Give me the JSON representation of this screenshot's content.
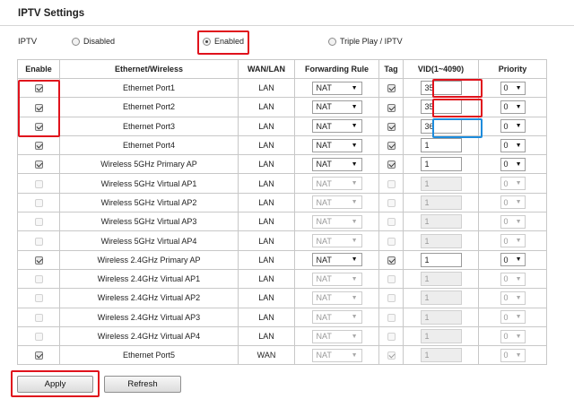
{
  "title": "IPTV Settings",
  "iptv": {
    "label": "IPTV",
    "options": [
      {
        "label": "Disabled",
        "checked": false
      },
      {
        "label": "Enabled",
        "checked": true
      },
      {
        "label": "Triple Play / IPTV",
        "checked": false
      }
    ]
  },
  "table": {
    "headers": [
      "Enable",
      "Ethernet/Wireless",
      "WAN/LAN",
      "Forwarding Rule",
      "Tag",
      "VID(1~4090)",
      "Priority"
    ],
    "rows": [
      {
        "enable": true,
        "name": "Ethernet Port1",
        "wanlan": "LAN",
        "rule": "NAT",
        "tag": true,
        "vid": "35",
        "priority": "0",
        "active": true
      },
      {
        "enable": true,
        "name": "Ethernet Port2",
        "wanlan": "LAN",
        "rule": "NAT",
        "tag": true,
        "vid": "35",
        "priority": "0",
        "active": true
      },
      {
        "enable": true,
        "name": "Ethernet Port3",
        "wanlan": "LAN",
        "rule": "NAT",
        "tag": true,
        "vid": "36",
        "priority": "0",
        "active": true
      },
      {
        "enable": true,
        "name": "Ethernet Port4",
        "wanlan": "LAN",
        "rule": "NAT",
        "tag": true,
        "vid": "1",
        "priority": "0",
        "active": true
      },
      {
        "enable": true,
        "name": "Wireless 5GHz Primary AP",
        "wanlan": "LAN",
        "rule": "NAT",
        "tag": true,
        "vid": "1",
        "priority": "0",
        "active": true
      },
      {
        "enable": false,
        "name": "Wireless 5GHz Virtual AP1",
        "wanlan": "LAN",
        "rule": "NAT",
        "tag": false,
        "vid": "1",
        "priority": "0",
        "active": false
      },
      {
        "enable": false,
        "name": "Wireless 5GHz Virtual AP2",
        "wanlan": "LAN",
        "rule": "NAT",
        "tag": false,
        "vid": "1",
        "priority": "0",
        "active": false
      },
      {
        "enable": false,
        "name": "Wireless 5GHz Virtual AP3",
        "wanlan": "LAN",
        "rule": "NAT",
        "tag": false,
        "vid": "1",
        "priority": "0",
        "active": false
      },
      {
        "enable": false,
        "name": "Wireless 5GHz Virtual AP4",
        "wanlan": "LAN",
        "rule": "NAT",
        "tag": false,
        "vid": "1",
        "priority": "0",
        "active": false
      },
      {
        "enable": true,
        "name": "Wireless 2.4GHz Primary AP",
        "wanlan": "LAN",
        "rule": "NAT",
        "tag": true,
        "vid": "1",
        "priority": "0",
        "active": true
      },
      {
        "enable": false,
        "name": "Wireless 2.4GHz Virtual AP1",
        "wanlan": "LAN",
        "rule": "NAT",
        "tag": false,
        "vid": "1",
        "priority": "0",
        "active": false
      },
      {
        "enable": false,
        "name": "Wireless 2.4GHz Virtual AP2",
        "wanlan": "LAN",
        "rule": "NAT",
        "tag": false,
        "vid": "1",
        "priority": "0",
        "active": false
      },
      {
        "enable": false,
        "name": "Wireless 2.4GHz Virtual AP3",
        "wanlan": "LAN",
        "rule": "NAT",
        "tag": false,
        "vid": "1",
        "priority": "0",
        "active": false
      },
      {
        "enable": false,
        "name": "Wireless 2.4GHz Virtual AP4",
        "wanlan": "LAN",
        "rule": "NAT",
        "tag": false,
        "vid": "1",
        "priority": "0",
        "active": false
      },
      {
        "enable": true,
        "name": "Ethernet Port5",
        "wanlan": "WAN",
        "rule": "NAT",
        "tag": true,
        "vid": "1",
        "priority": "0",
        "active": false
      }
    ]
  },
  "buttons": {
    "apply": "Apply",
    "refresh": "Refresh"
  },
  "colors": {
    "highlight_red": "#e0121c",
    "highlight_blue": "#1e8cdc"
  }
}
